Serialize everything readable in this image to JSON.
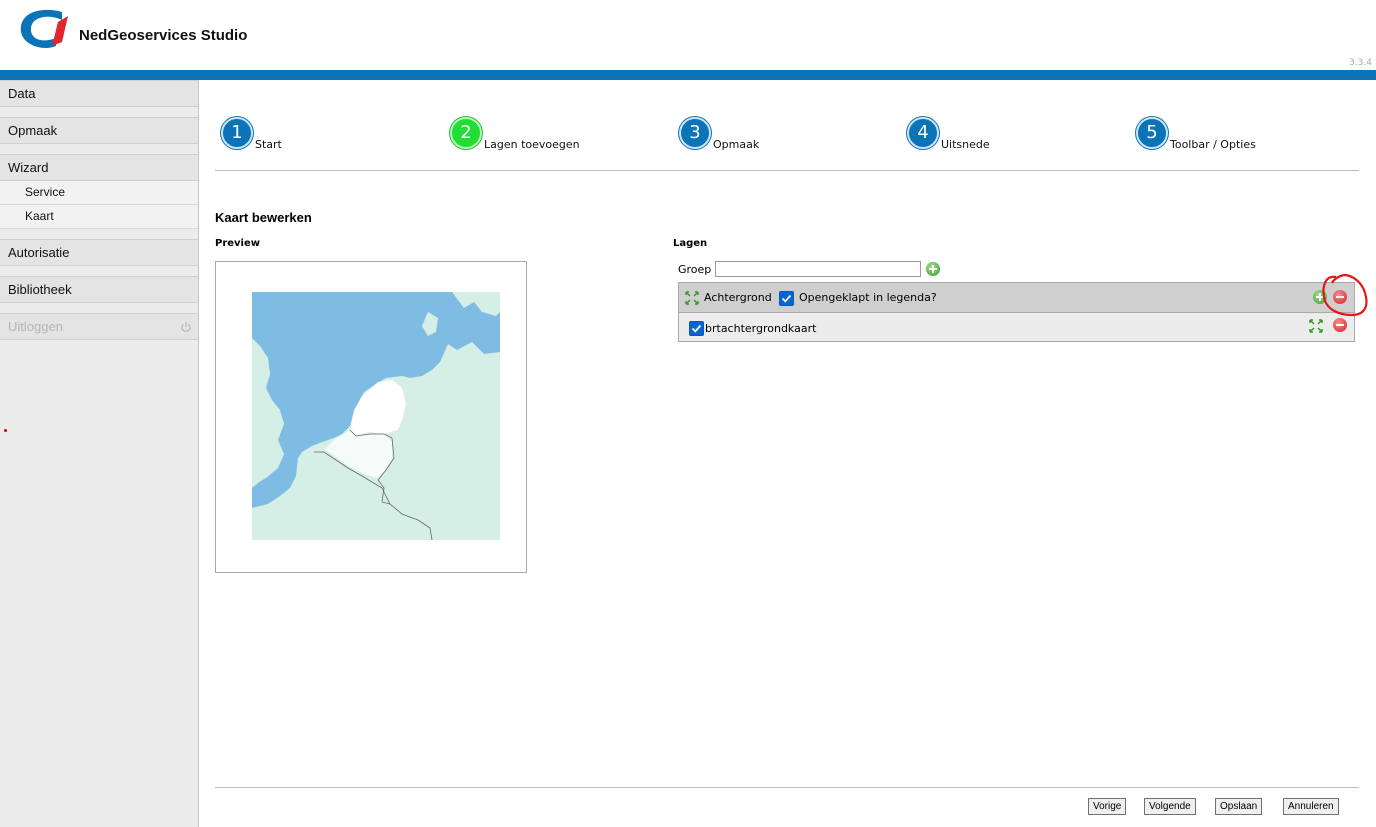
{
  "header": {
    "title": "NedGeoservices Studio",
    "version": "3.3.4",
    "brand_color": "#0b74b8"
  },
  "sidebar": {
    "items": [
      {
        "label": "Data"
      },
      {
        "label": "Opmaak"
      },
      {
        "label": "Wizard",
        "children": [
          {
            "label": "Service"
          },
          {
            "label": "Kaart"
          }
        ]
      },
      {
        "label": "Autorisatie"
      },
      {
        "label": "Bibliotheek"
      },
      {
        "label": "Uitloggen",
        "disabled": true,
        "icon": "power-icon"
      }
    ]
  },
  "wizard": {
    "steps": [
      {
        "number": "1",
        "label": "Start"
      },
      {
        "number": "2",
        "label": "Lagen toevoegen",
        "active": true
      },
      {
        "number": "3",
        "label": "Opmaak"
      },
      {
        "number": "4",
        "label": "Uitsnede"
      },
      {
        "number": "5",
        "label": "Toolbar / Opties"
      }
    ]
  },
  "main": {
    "title": "Kaart bewerken",
    "preview": {
      "heading": "Preview"
    },
    "layers": {
      "heading": "Lagen",
      "groep_label": "Groep",
      "groep_value": "",
      "group": {
        "name": "Achtergrond",
        "expanded_checked": true,
        "expanded_label": "Opengeklapt in legenda?"
      },
      "items": [
        {
          "name": "brtachtergrondkaart",
          "checked": true
        }
      ]
    }
  },
  "footer": {
    "prev": "Vorige",
    "next": "Volgende",
    "save": "Opslaan",
    "cancel": "Annuleren"
  }
}
